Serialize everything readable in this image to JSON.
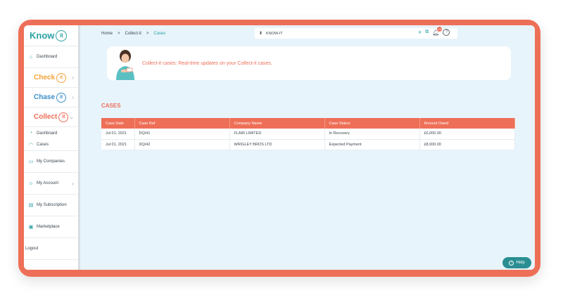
{
  "colors": {
    "accent": "#ee6f57",
    "teal": "#2aa0a4",
    "check": "#f4a23a",
    "chase": "#3b8fc9"
  },
  "sidebar": {
    "logo": {
      "word": "Know",
      "mark": "it"
    },
    "dashboard": "Dashboard",
    "products": [
      {
        "word": "Check",
        "mark": "it"
      },
      {
        "word": "Chase",
        "mark": "it"
      },
      {
        "word": "Collect",
        "mark": "it"
      }
    ],
    "collect_items": [
      "Dashboard",
      "Cases"
    ],
    "items": [
      "My Companies",
      "My Account",
      "My Subscription",
      "Marketplace"
    ],
    "logout": "Logout"
  },
  "breadcrumb": [
    "Home",
    ">",
    "Collect-it",
    ">",
    "Cases"
  ],
  "search": {
    "value": "KNOW-IT"
  },
  "notifications_count": "10",
  "banner": {
    "text": "Collect-it cases: Real-time updates on your Collect-it cases."
  },
  "cases": {
    "title": "CASES",
    "columns": [
      "Case Date",
      "Case Ref",
      "Company Name",
      "Case Status",
      "Amount Owed"
    ],
    "rows": [
      [
        "Jul 01, 2021",
        "DQ/41",
        "FLAIR LIMITED",
        "In Recovery",
        "£6,000.00"
      ],
      [
        "Jul 01, 2021",
        "DQ/42",
        "WRIGLEY BROS LTD",
        "Expected Payment",
        "£8,000.00"
      ]
    ]
  },
  "help": {
    "label": "Help"
  }
}
